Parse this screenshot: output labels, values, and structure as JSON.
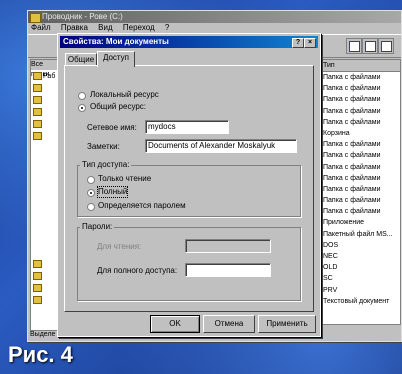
{
  "explorer": {
    "title": "Проводник - Рове (C:)",
    "menu": [
      "Файл",
      "Правка",
      "Вид",
      "Переход",
      "?"
    ],
    "tree_header": "Все папки",
    "tree_items": [
      "Раб",
      "",
      "",
      "",
      "",
      "",
      "",
      "",
      "",
      "",
      "",
      "",
      ""
    ],
    "status_text": "Выделе",
    "list_header": "Тип",
    "list_rows": [
      "Папка с файлами",
      "Папка с файлами",
      "Папка с файлами",
      "Папка с файлами",
      "Папка с файлами",
      "Корзина",
      "Папка с файлами",
      "Папка с файлами",
      "Папка с файлами",
      "Папка с файлами",
      "Папка с файлами",
      "Папка с файлами",
      "Папка с файлами",
      "Приложение",
      "Пакетный файл MS...",
      "DOS",
      "NEC",
      "OLD",
      "SC",
      "PRV",
      "Текстовый документ"
    ]
  },
  "dialog": {
    "title": "Свойства: Мои документы",
    "help_btn": "?",
    "close_btn": "×",
    "tabs": [
      "Общие",
      "Доступ"
    ],
    "local_resource": "Локальный ресурс",
    "shared_resource": "Общий ресурс:",
    "share_name_label": "Сетевое имя:",
    "share_name_value": "mydocs",
    "comment_label": "Заметки:",
    "comment_value": "Documents of Alexander Moskalyuk",
    "access_type_label": "Тип доступа:",
    "access_readonly": "Только чтение",
    "access_full": "Полный",
    "access_password": "Определяется паролем",
    "passwords_label": "Пароли:",
    "readonly_pw_label": "Для чтения:",
    "full_pw_label": "Для полного доступа:",
    "full_pw_value": "",
    "ok": "OK",
    "cancel": "Отмена",
    "apply": "Применить"
  },
  "caption": "Рис. 4"
}
